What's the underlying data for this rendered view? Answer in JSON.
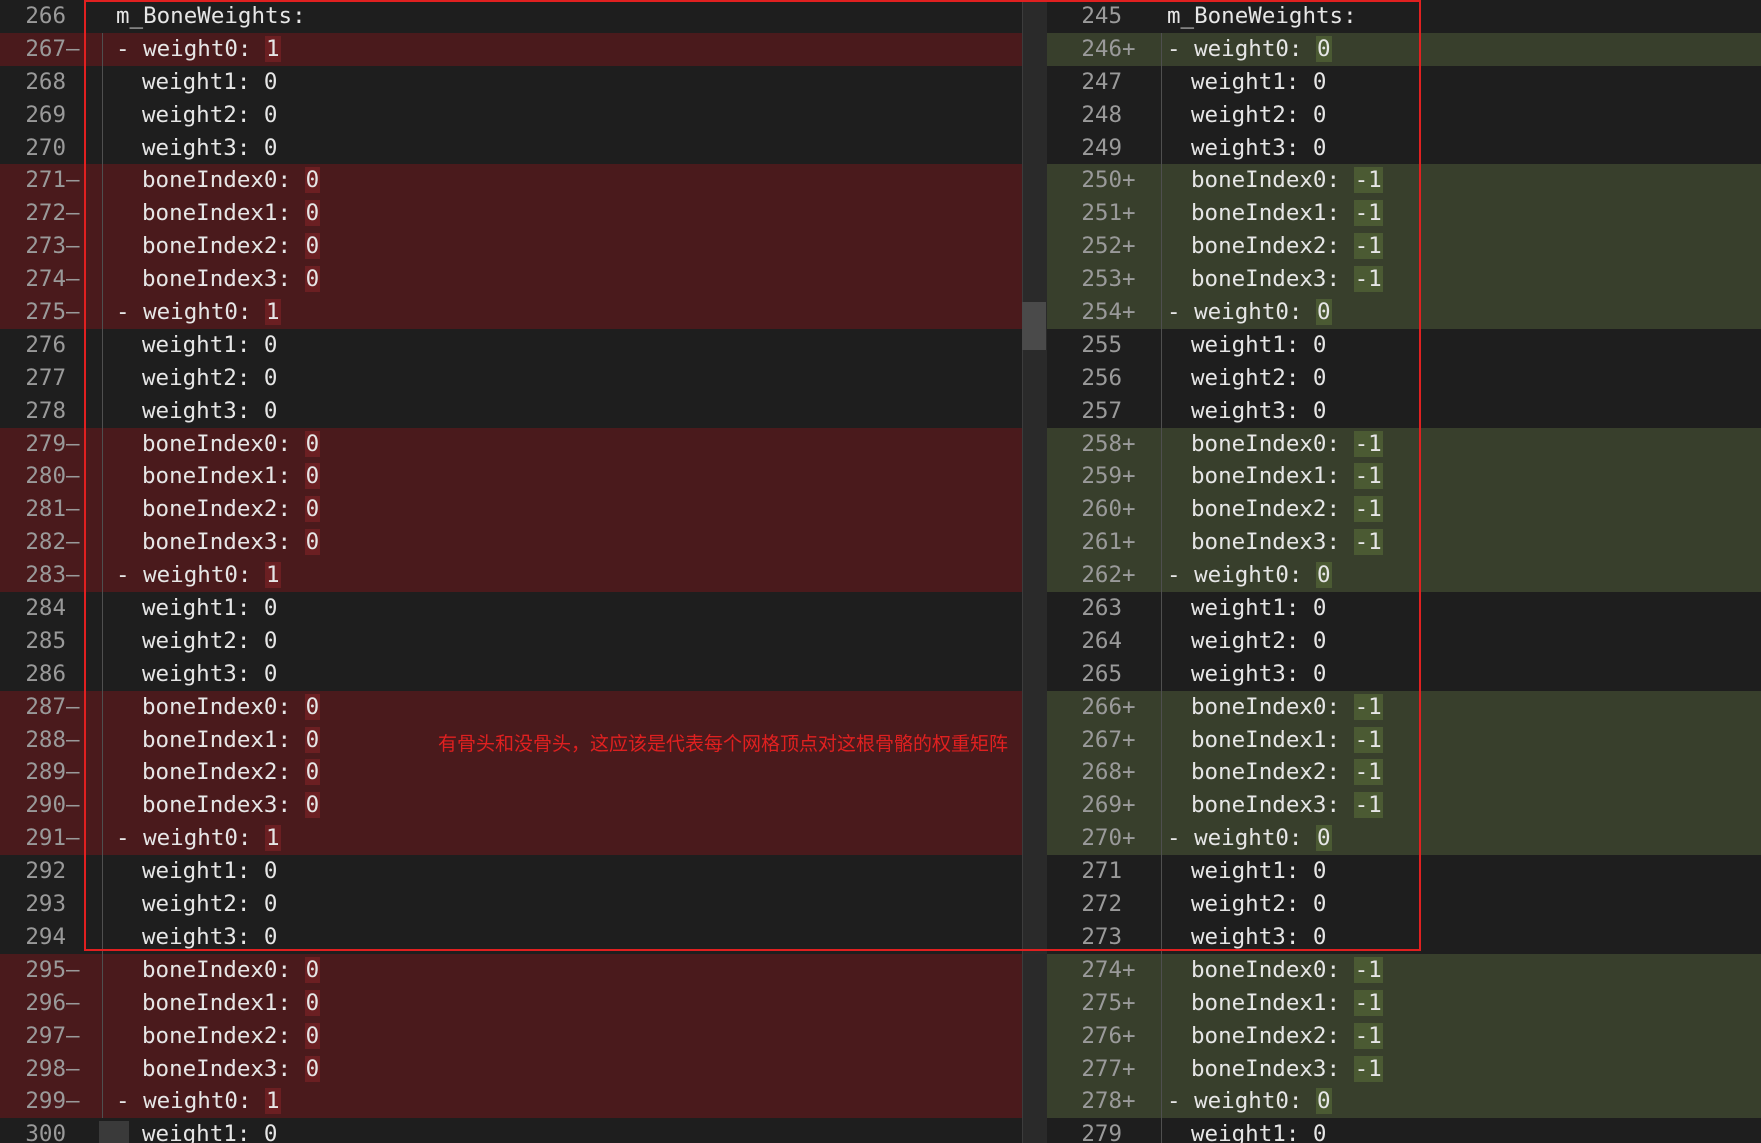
{
  "colors": {
    "background": "#1e1e1e",
    "removed_line": "#4a1a1c",
    "added_line": "#383f2c",
    "removed_value": "#6b1f22",
    "added_value": "#4b5a33",
    "annotation": "#e02020"
  },
  "left_pane": {
    "rows": [
      {
        "ln": "266",
        "type": "ctx",
        "text": "m_BoneWeights:",
        "marker": ""
      },
      {
        "ln": "267",
        "type": "removed",
        "text": "weight0: 1",
        "marker": "—"
      },
      {
        "ln": "268",
        "type": "ctx",
        "text": "weight1: 0",
        "marker": ""
      },
      {
        "ln": "269",
        "type": "ctx",
        "text": "weight2: 0",
        "marker": ""
      },
      {
        "ln": "270",
        "type": "ctx",
        "text": "weight3: 0",
        "marker": ""
      },
      {
        "ln": "271",
        "type": "removed",
        "text": "boneIndex0: 0",
        "marker": "—"
      },
      {
        "ln": "272",
        "type": "removed",
        "text": "boneIndex1: 0",
        "marker": "—"
      },
      {
        "ln": "273",
        "type": "removed",
        "text": "boneIndex2: 0",
        "marker": "—"
      },
      {
        "ln": "274",
        "type": "removed",
        "text": "boneIndex3: 0",
        "marker": "—"
      },
      {
        "ln": "275",
        "type": "removed",
        "text": "weight0: 1",
        "marker": "—"
      },
      {
        "ln": "276",
        "type": "ctx",
        "text": "weight1: 0",
        "marker": ""
      },
      {
        "ln": "277",
        "type": "ctx",
        "text": "weight2: 0",
        "marker": ""
      },
      {
        "ln": "278",
        "type": "ctx",
        "text": "weight3: 0",
        "marker": ""
      },
      {
        "ln": "279",
        "type": "removed",
        "text": "boneIndex0: 0",
        "marker": "—"
      },
      {
        "ln": "280",
        "type": "removed",
        "text": "boneIndex1: 0",
        "marker": "—"
      },
      {
        "ln": "281",
        "type": "removed",
        "text": "boneIndex2: 0",
        "marker": "—"
      },
      {
        "ln": "282",
        "type": "removed",
        "text": "boneIndex3: 0",
        "marker": "—"
      },
      {
        "ln": "283",
        "type": "removed",
        "text": "weight0: 1",
        "marker": "—"
      },
      {
        "ln": "284",
        "type": "ctx",
        "text": "weight1: 0",
        "marker": ""
      },
      {
        "ln": "285",
        "type": "ctx",
        "text": "weight2: 0",
        "marker": ""
      },
      {
        "ln": "286",
        "type": "ctx",
        "text": "weight3: 0",
        "marker": ""
      },
      {
        "ln": "287",
        "type": "removed",
        "text": "boneIndex0: 0",
        "marker": "—"
      },
      {
        "ln": "288",
        "type": "removed",
        "text": "boneIndex1: 0",
        "marker": "—"
      },
      {
        "ln": "289",
        "type": "removed",
        "text": "boneIndex2: 0",
        "marker": "—"
      },
      {
        "ln": "290",
        "type": "removed",
        "text": "boneIndex3: 0",
        "marker": "—"
      },
      {
        "ln": "291",
        "type": "removed",
        "text": "weight0: 1",
        "marker": "—"
      },
      {
        "ln": "292",
        "type": "ctx",
        "text": "weight1: 0",
        "marker": ""
      },
      {
        "ln": "293",
        "type": "ctx",
        "text": "weight2: 0",
        "marker": ""
      },
      {
        "ln": "294",
        "type": "ctx",
        "text": "weight3: 0",
        "marker": ""
      },
      {
        "ln": "295",
        "type": "removed",
        "text": "boneIndex0: 0",
        "marker": "—"
      },
      {
        "ln": "296",
        "type": "removed",
        "text": "boneIndex1: 0",
        "marker": "—"
      },
      {
        "ln": "297",
        "type": "removed",
        "text": "boneIndex2: 0",
        "marker": "—"
      },
      {
        "ln": "298",
        "type": "removed",
        "text": "boneIndex3: 0",
        "marker": "—"
      },
      {
        "ln": "299",
        "type": "removed",
        "text": "weight0: 1",
        "marker": "—"
      },
      {
        "ln": "300",
        "type": "ctx",
        "text": "weight1: 0",
        "marker": ""
      }
    ]
  },
  "right_pane": {
    "rows": [
      {
        "ln": "245",
        "type": "ctx",
        "text": "m_BoneWeights:",
        "marker": ""
      },
      {
        "ln": "246",
        "type": "added",
        "text": "weight0: 0",
        "marker": "+"
      },
      {
        "ln": "247",
        "type": "ctx",
        "text": "weight1: 0",
        "marker": ""
      },
      {
        "ln": "248",
        "type": "ctx",
        "text": "weight2: 0",
        "marker": ""
      },
      {
        "ln": "249",
        "type": "ctx",
        "text": "weight3: 0",
        "marker": ""
      },
      {
        "ln": "250",
        "type": "added",
        "text": "boneIndex0: -1",
        "marker": "+"
      },
      {
        "ln": "251",
        "type": "added",
        "text": "boneIndex1: -1",
        "marker": "+"
      },
      {
        "ln": "252",
        "type": "added",
        "text": "boneIndex2: -1",
        "marker": "+"
      },
      {
        "ln": "253",
        "type": "added",
        "text": "boneIndex3: -1",
        "marker": "+"
      },
      {
        "ln": "254",
        "type": "added",
        "text": "weight0: 0",
        "marker": "+"
      },
      {
        "ln": "255",
        "type": "ctx",
        "text": "weight1: 0",
        "marker": ""
      },
      {
        "ln": "256",
        "type": "ctx",
        "text": "weight2: 0",
        "marker": ""
      },
      {
        "ln": "257",
        "type": "ctx",
        "text": "weight3: 0",
        "marker": ""
      },
      {
        "ln": "258",
        "type": "added",
        "text": "boneIndex0: -1",
        "marker": "+"
      },
      {
        "ln": "259",
        "type": "added",
        "text": "boneIndex1: -1",
        "marker": "+"
      },
      {
        "ln": "260",
        "type": "added",
        "text": "boneIndex2: -1",
        "marker": "+"
      },
      {
        "ln": "261",
        "type": "added",
        "text": "boneIndex3: -1",
        "marker": "+"
      },
      {
        "ln": "262",
        "type": "added",
        "text": "weight0: 0",
        "marker": "+"
      },
      {
        "ln": "263",
        "type": "ctx",
        "text": "weight1: 0",
        "marker": ""
      },
      {
        "ln": "264",
        "type": "ctx",
        "text": "weight2: 0",
        "marker": ""
      },
      {
        "ln": "265",
        "type": "ctx",
        "text": "weight3: 0",
        "marker": ""
      },
      {
        "ln": "266",
        "type": "added",
        "text": "boneIndex0: -1",
        "marker": "+"
      },
      {
        "ln": "267",
        "type": "added",
        "text": "boneIndex1: -1",
        "marker": "+"
      },
      {
        "ln": "268",
        "type": "added",
        "text": "boneIndex2: -1",
        "marker": "+"
      },
      {
        "ln": "269",
        "type": "added",
        "text": "boneIndex3: -1",
        "marker": "+"
      },
      {
        "ln": "270",
        "type": "added",
        "text": "weight0: 0",
        "marker": "+"
      },
      {
        "ln": "271",
        "type": "ctx",
        "text": "weight1: 0",
        "marker": ""
      },
      {
        "ln": "272",
        "type": "ctx",
        "text": "weight2: 0",
        "marker": ""
      },
      {
        "ln": "273",
        "type": "ctx",
        "text": "weight3: 0",
        "marker": ""
      },
      {
        "ln": "274",
        "type": "added",
        "text": "boneIndex0: -1",
        "marker": "+"
      },
      {
        "ln": "275",
        "type": "added",
        "text": "boneIndex1: -1",
        "marker": "+"
      },
      {
        "ln": "276",
        "type": "added",
        "text": "boneIndex2: -1",
        "marker": "+"
      },
      {
        "ln": "277",
        "type": "added",
        "text": "boneIndex3: -1",
        "marker": "+"
      },
      {
        "ln": "278",
        "type": "added",
        "text": "weight0: 0",
        "marker": "+"
      },
      {
        "ln": "279",
        "type": "ctx",
        "text": "weight1: 0",
        "marker": ""
      }
    ]
  },
  "annotation": {
    "note": "有骨头和没骨头，这应该是代表每个网格顶点对这根骨骼的权重矩阵"
  }
}
